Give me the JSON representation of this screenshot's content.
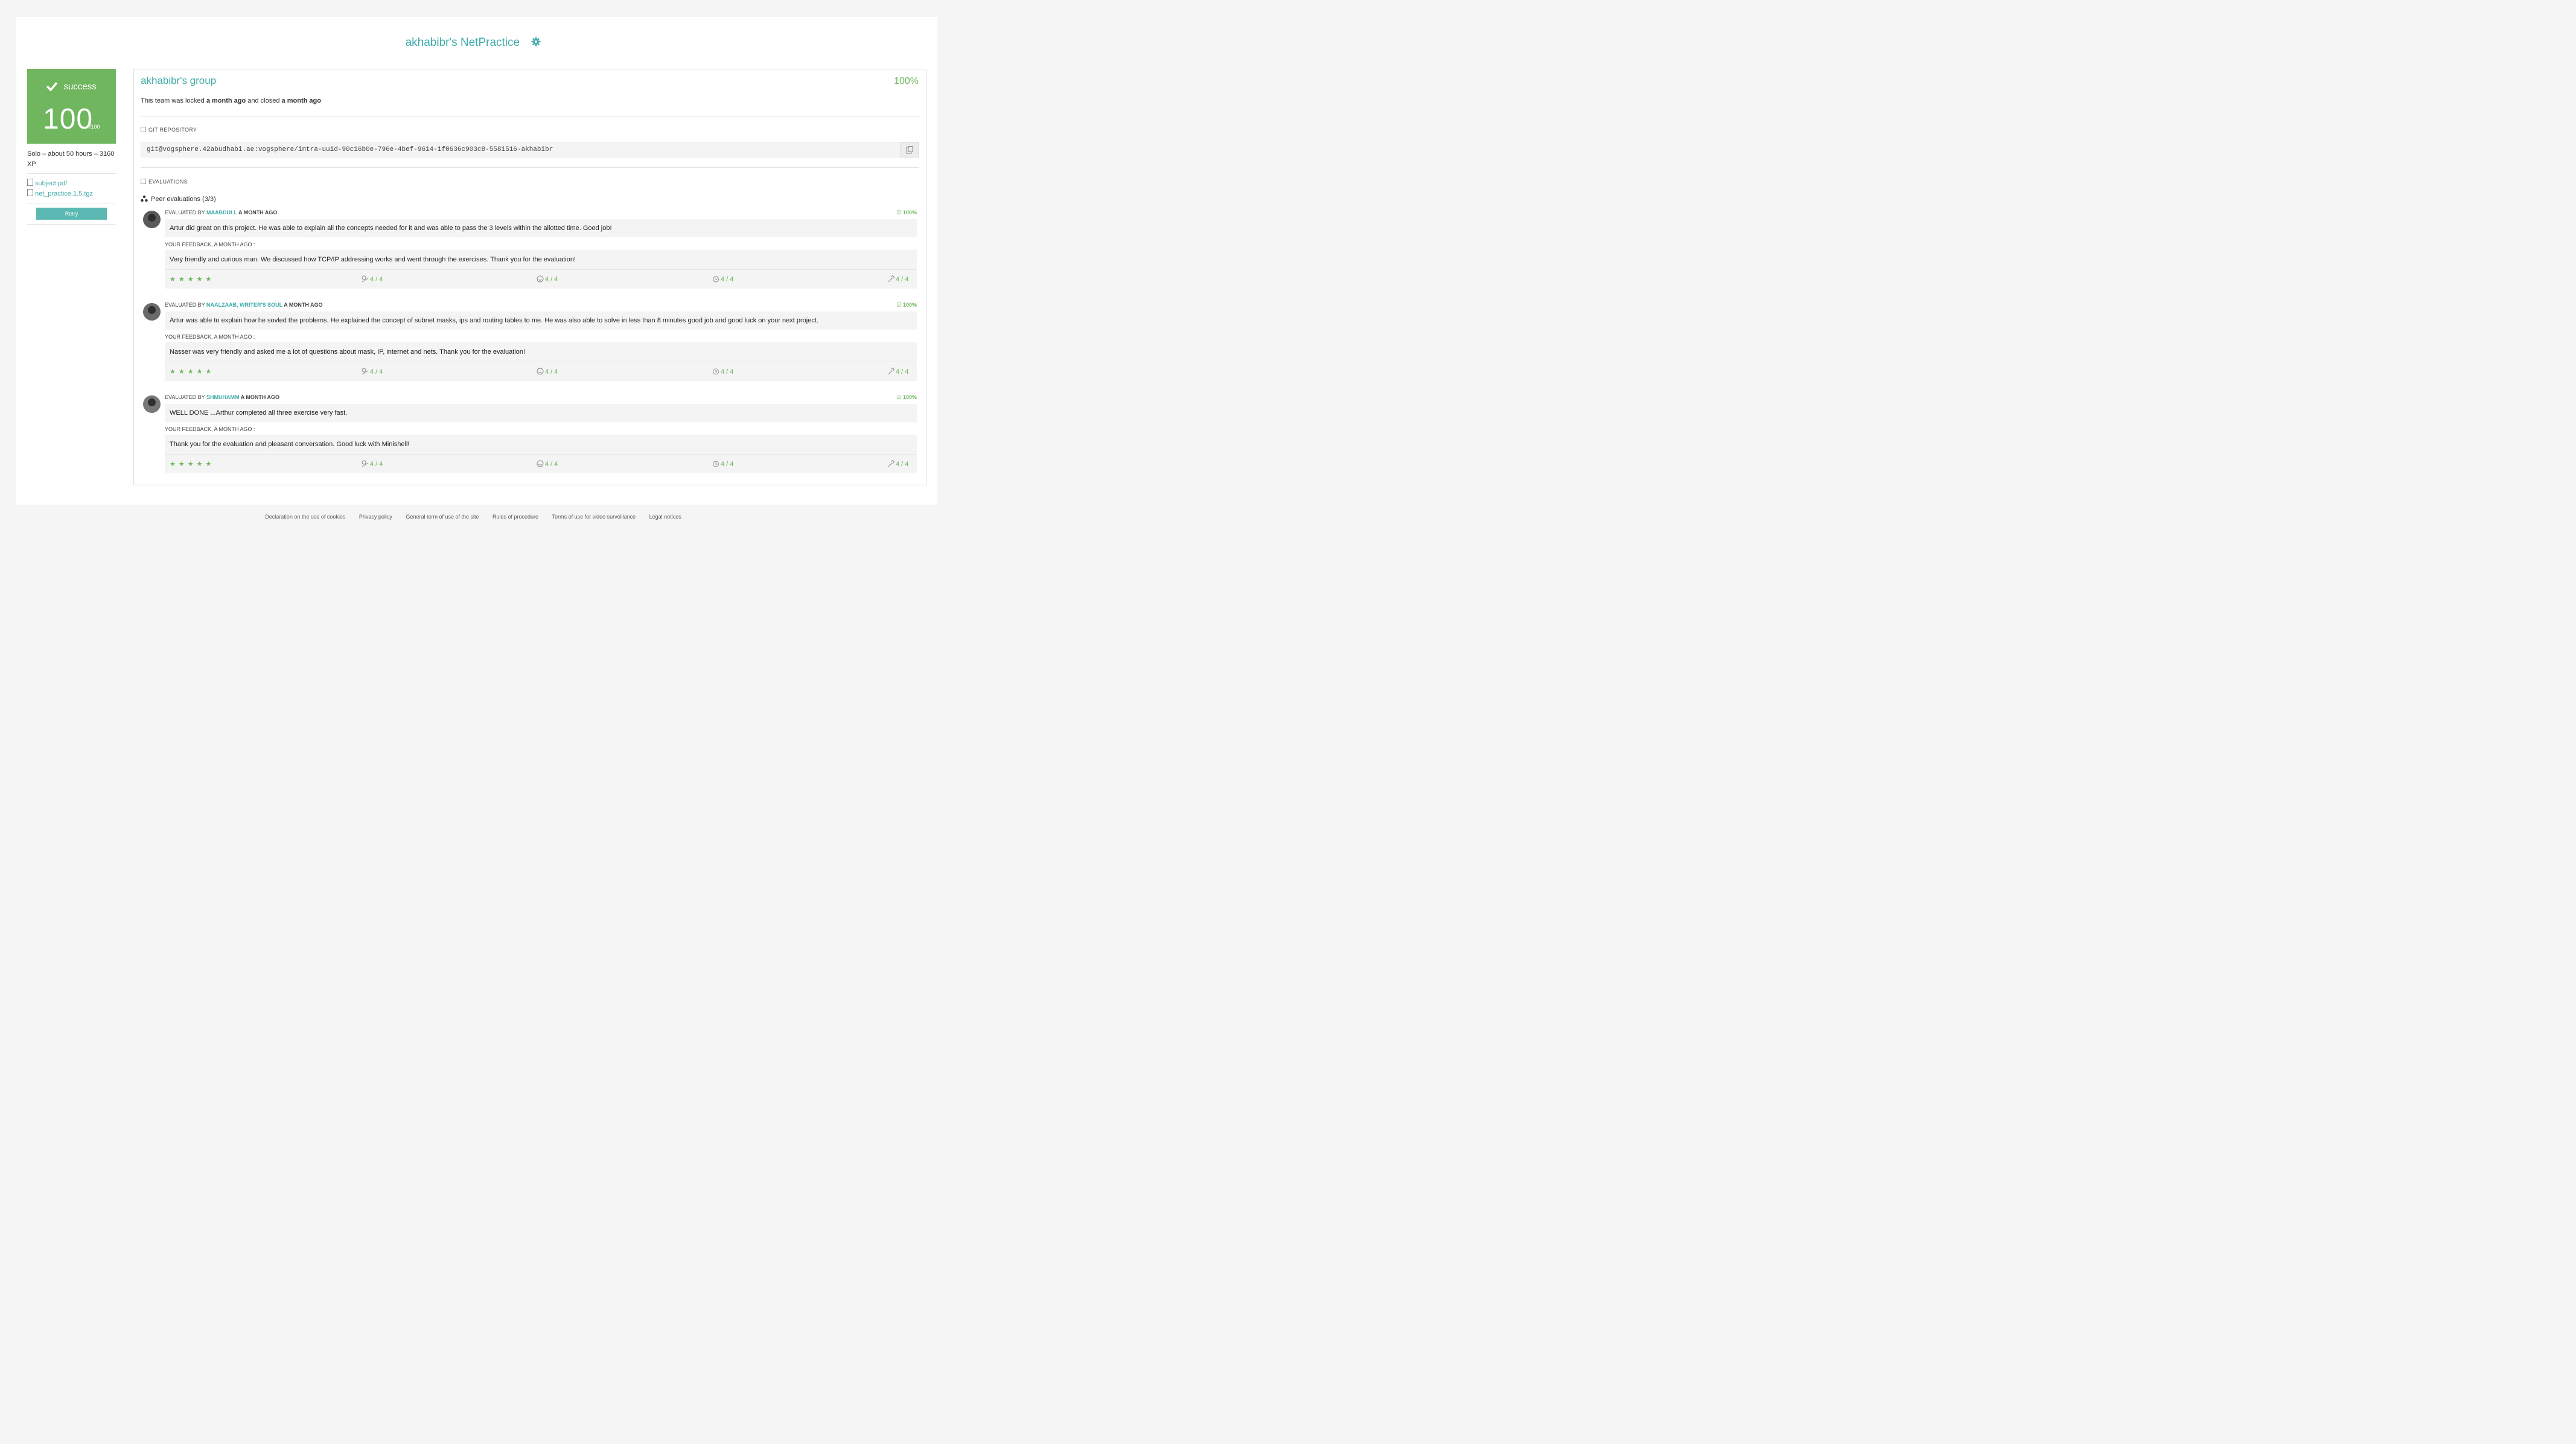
{
  "page": {
    "title": "akhabibr's NetPractice"
  },
  "sidebar": {
    "status": "success",
    "score": "100",
    "score_max": "/100",
    "meta": "Solo – about 50 hours – 3160 XP",
    "files": [
      "subject.pdf",
      "net_practice.1.5.tgz"
    ],
    "retry_label": "Retry"
  },
  "group": {
    "name": "akhabibr's group",
    "percent": "100%",
    "locked_prefix": "This team was locked ",
    "locked_when": "a month ago",
    "closed_prefix": " and closed ",
    "closed_when": "a month ago"
  },
  "git": {
    "label": "GIT REPOSITORY",
    "url": "git@vogsphere.42abudhabi.ae:vogsphere/intra-uuid-90c16b0e-796e-4bef-9614-1f0636c903c8-5581516-akhabibr"
  },
  "evaluations": {
    "label": "EVALUATIONS",
    "peer_title": "Peer evaluations (3/3)",
    "items": [
      {
        "evaluated_by": "EVALUATED BY ",
        "login": "MAABDULL",
        "when": " A MONTH AGO",
        "percent": "100%",
        "comment": "Artur did great on this project. He was able to explain all the concepts needed for it and was able to pass the 3 levels within the allotted time. Good job!",
        "feedback_label": "YOUR FEEDBACK, A MONTH AGO :",
        "feedback": "Very friendly and curious man. We discussed how TCP/IP addressing works and went through the exercises. Thank you for the evaluation!",
        "stars": "★★★★★",
        "nice": "4 / 4",
        "interested": "4 / 4",
        "punctuality": "4 / 4",
        "rigor": "4 / 4"
      },
      {
        "evaluated_by": "EVALUATED BY ",
        "login": "NAALZAAB, WRITER'S SOUL",
        "when": " A MONTH AGO",
        "percent": "100%",
        "comment": "Artur was able to explain how he sovled the problems. He explained the concept of subnet masks, ips and routing tables to me. He was also able to solve in less than 8 minutes good job and good luck on your next project.",
        "feedback_label": "YOUR FEEDBACK, A MONTH AGO :",
        "feedback": "Nasser was very friendly and asked me a lot of questions about mask, IP, internet and nets. Thank you for the evaluation!",
        "stars": "★★★★★",
        "nice": "4 / 4",
        "interested": "4 / 4",
        "punctuality": "4 / 4",
        "rigor": "4 / 4"
      },
      {
        "evaluated_by": "EVALUATED BY ",
        "login": "SHMUHAMM",
        "when": " A MONTH AGO",
        "percent": "100%",
        "comment": "WELL DONE ...Arthur completed all three exercise very fast.",
        "feedback_label": "YOUR FEEDBACK, A MONTH AGO :",
        "feedback": "Thank you for the evaluation and pleasant conversation. Good luck with Minishell!",
        "stars": "★★★★★",
        "nice": "4 / 4",
        "interested": "4 / 4",
        "punctuality": "4 / 4",
        "rigor": "4 / 4"
      }
    ]
  },
  "footer": {
    "links": [
      "Declaration on the use of cookies",
      "Privacy policy",
      "General term of use of the site",
      "Rules of procedure",
      "Terms of use for video surveillance",
      "Legal notices"
    ]
  },
  "colors": {
    "accent": "#3eaba8",
    "success": "#6fb65e",
    "retry": "#5cb8b2"
  },
  "icons": [
    "gear-icon",
    "check-icon",
    "document-icon",
    "copy-icon",
    "checkbox-icon",
    "users-icon",
    "star-icon",
    "nice-icon",
    "smile-icon",
    "alarm-clock-icon",
    "hammer-icon"
  ]
}
